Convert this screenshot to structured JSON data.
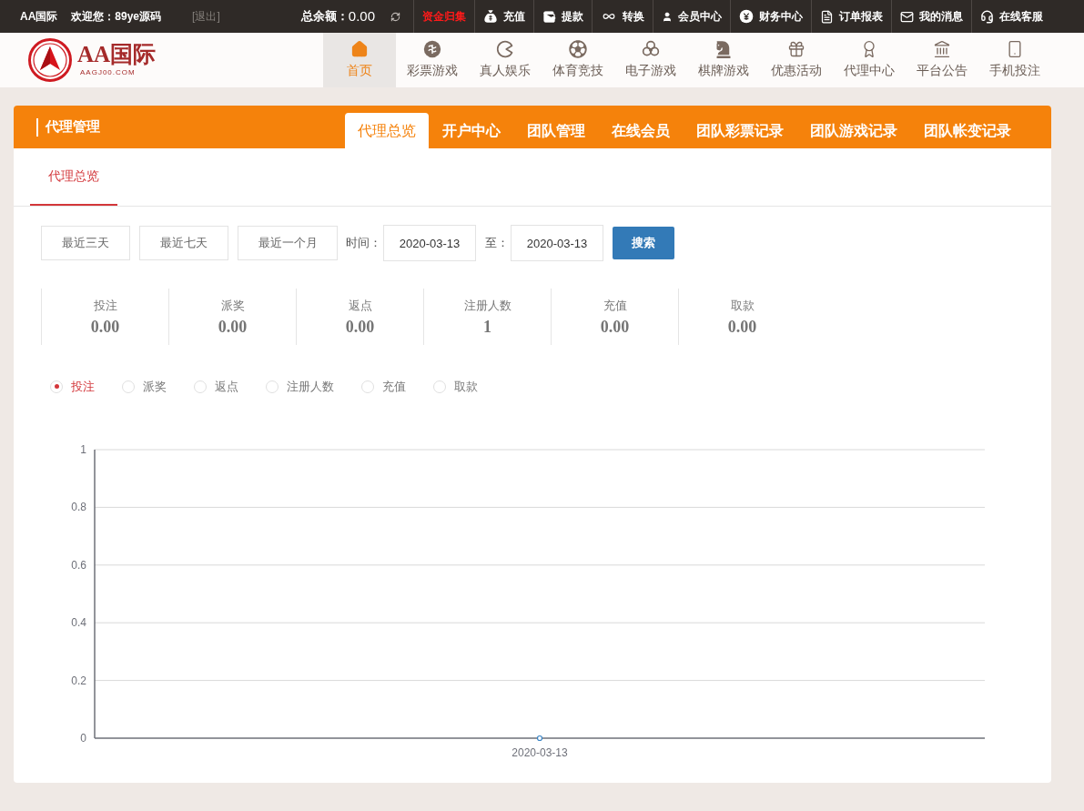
{
  "top_bar": {
    "site_name": "AA国际",
    "welcome": "欢迎您：89ye源码",
    "logout": "[退出]",
    "balance_label": "总余额：",
    "balance": "0.00",
    "links": [
      {
        "label": "资金归集",
        "kind": "alert"
      },
      {
        "label": "充值",
        "kind": "normal"
      },
      {
        "label": "提款",
        "kind": "normal"
      },
      {
        "label": "转换",
        "kind": "normal"
      },
      {
        "label": "会员中心",
        "kind": "normal"
      },
      {
        "label": "财务中心",
        "kind": "normal"
      },
      {
        "label": "订单报表",
        "kind": "normal"
      },
      {
        "label": "我的消息",
        "kind": "normal"
      },
      {
        "label": "在线客服",
        "kind": "normal"
      }
    ]
  },
  "header": {
    "logo": {
      "name": "AA国际",
      "domain": "AAGJ00.COM"
    },
    "nav": [
      {
        "label": "首页",
        "selected": true
      },
      {
        "label": "彩票游戏",
        "selected": false
      },
      {
        "label": "真人娱乐",
        "selected": false
      },
      {
        "label": "体育竞技",
        "selected": false
      },
      {
        "label": "电子游戏",
        "selected": false
      },
      {
        "label": "棋牌游戏",
        "selected": false
      },
      {
        "label": "优惠活动",
        "selected": false
      },
      {
        "label": "代理中心",
        "selected": false
      },
      {
        "label": "平台公告",
        "selected": false
      },
      {
        "label": "手机投注",
        "selected": false
      }
    ]
  },
  "panel": {
    "title": "代理管理",
    "tabs": [
      {
        "label": "代理总览",
        "selected": true
      },
      {
        "label": "开户中心",
        "selected": false
      },
      {
        "label": "团队管理",
        "selected": false
      },
      {
        "label": "在线会员",
        "selected": false
      },
      {
        "label": "团队彩票记录",
        "selected": false
      },
      {
        "label": "团队游戏记录",
        "selected": false
      },
      {
        "label": "团队帐变记录",
        "selected": false
      }
    ],
    "subtabs": [
      {
        "label": "代理总览",
        "selected": true
      }
    ],
    "filters": {
      "quick_ranges": [
        "最近三天",
        "最近七天",
        "最近一个月"
      ],
      "time_label": "时间：",
      "start_date": "2020-03-13",
      "to_label": "至：",
      "end_date": "2020-03-13",
      "search_button": "搜索"
    },
    "stats": [
      {
        "label": "投注",
        "value": "0.00"
      },
      {
        "label": "派奖",
        "value": "0.00"
      },
      {
        "label": "返点",
        "value": "0.00"
      },
      {
        "label": "注册人数",
        "value": "1"
      },
      {
        "label": "充值",
        "value": "0.00"
      },
      {
        "label": "取款",
        "value": "0.00"
      }
    ],
    "radios": [
      {
        "label": "投注",
        "selected": true
      },
      {
        "label": "派奖",
        "selected": false
      },
      {
        "label": "返点",
        "selected": false
      },
      {
        "label": "注册人数",
        "selected": false
      },
      {
        "label": "充值",
        "selected": false
      },
      {
        "label": "取款",
        "selected": false
      }
    ],
    "chart_data": {
      "type": "line",
      "grid": true,
      "categories": [
        "2020-03-13"
      ],
      "series": [
        {
          "color": "#3a84c4",
          "marker": "circle",
          "values": [
            0
          ]
        }
      ],
      "ylim": [
        0,
        1
      ],
      "yticks": [
        0,
        0.2,
        0.4,
        0.6,
        0.8,
        1
      ]
    }
  }
}
